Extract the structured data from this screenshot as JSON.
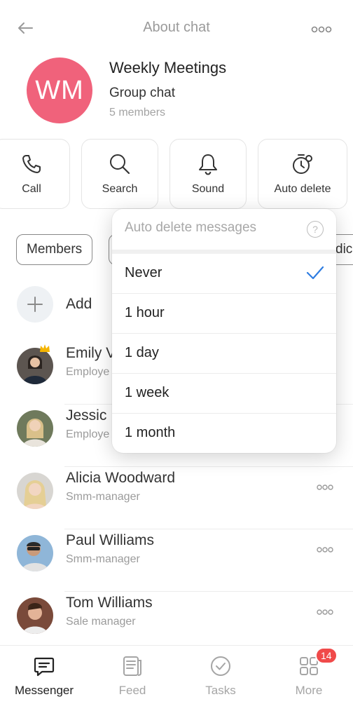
{
  "header": {
    "title": "About chat"
  },
  "chat": {
    "initials": "WM",
    "name": "Weekly Meetings",
    "type": "Group chat",
    "members": "5 members",
    "avatar_color": "#f0627b"
  },
  "actions": [
    {
      "label": "Call",
      "icon": "phone-icon"
    },
    {
      "label": "Search",
      "icon": "search-icon"
    },
    {
      "label": "Sound",
      "icon": "bell-icon"
    },
    {
      "label": "Auto delete",
      "icon": "timer-icon"
    }
  ],
  "tabs": {
    "members": "Members",
    "partial_right": "dic"
  },
  "add_label": "Add",
  "members": [
    {
      "name": "Emily V",
      "role": "Employe",
      "avatar": "emily-avatar",
      "crown": true
    },
    {
      "name": "Jessic",
      "role": "Employe",
      "avatar": "jessica-avatar"
    },
    {
      "name": "Alicia Woodward",
      "role": "Smm-manager",
      "avatar": "alicia-avatar"
    },
    {
      "name": "Paul Williams",
      "role": "Smm-manager",
      "avatar": "paul-avatar"
    },
    {
      "name": "Tom Williams",
      "role": "Sale manager",
      "avatar": "tom-avatar"
    }
  ],
  "dropdown": {
    "title": "Auto delete messages",
    "options": [
      "Never",
      "1 hour",
      "1 day",
      "1 week",
      "1 month"
    ],
    "selected": "Never",
    "check_color": "#2f7de1"
  },
  "nav": {
    "items": [
      {
        "label": "Messenger",
        "icon": "chat-bubble-icon",
        "active": true
      },
      {
        "label": "Feed",
        "icon": "feed-icon"
      },
      {
        "label": "Tasks",
        "icon": "check-circle-icon"
      },
      {
        "label": "More",
        "icon": "grid-icon",
        "badge": "14"
      }
    ],
    "badge_color": "#f04a4a"
  }
}
